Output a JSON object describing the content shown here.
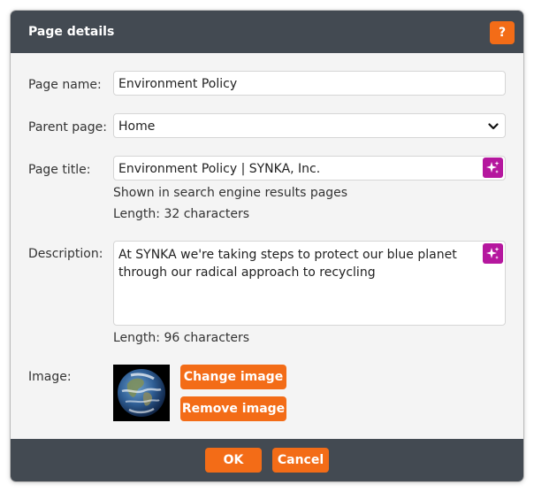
{
  "dialog": {
    "title": "Page details",
    "help_label": "?"
  },
  "form": {
    "page_name": {
      "label": "Page name:",
      "value": "Environment Policy"
    },
    "parent_page": {
      "label": "Parent page:",
      "value": "Home"
    },
    "page_title": {
      "label": "Page title:",
      "value": "Environment Policy | SYNKA, Inc.",
      "hint": "Shown in search engine results pages",
      "length": "Length: 32 characters"
    },
    "description": {
      "label": "Description:",
      "value": "At SYNKA we're taking steps to protect our blue planet\nthrough our radical approach to recycling",
      "length": "Length: 96 characters"
    },
    "image": {
      "label": "Image:",
      "change_label": "Change image",
      "remove_label": "Remove image"
    }
  },
  "footer": {
    "ok_label": "OK",
    "cancel_label": "Cancel"
  },
  "icons": {
    "help": "question-icon",
    "dropdown": "chevron-down-icon",
    "ai": "sparkle-icon"
  },
  "colors": {
    "header_bg": "#434a52",
    "accent": "#f36c17",
    "ai_button": "#b5179e",
    "body_bg": "#f4f4f4"
  }
}
